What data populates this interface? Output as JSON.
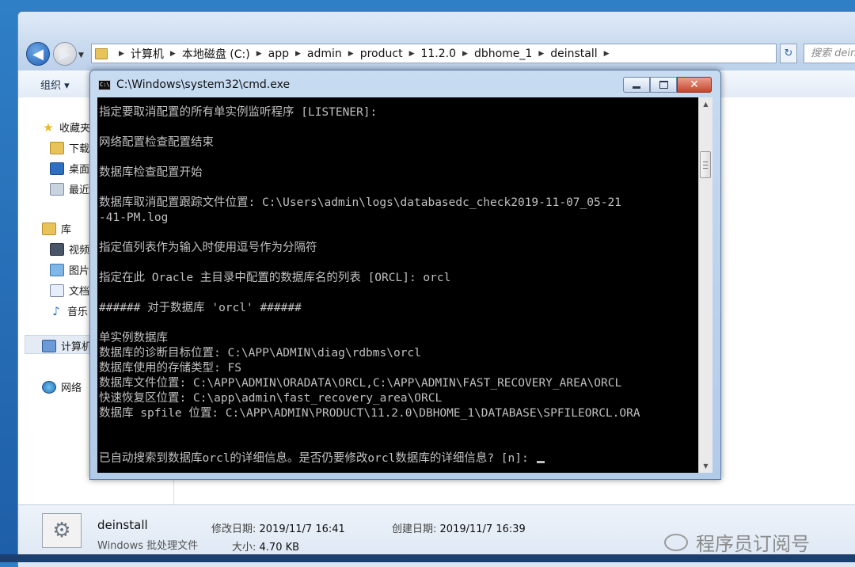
{
  "explorer": {
    "address_crumbs": [
      "计算机",
      "本地磁盘 (C:)",
      "app",
      "admin",
      "product",
      "11.2.0",
      "dbhome_1",
      "deinstall"
    ],
    "search_placeholder": "搜索 deinstall",
    "toolbar": {
      "organize_label": "组织 ▾"
    },
    "sidebar": {
      "favorites": "收藏夹",
      "downloads": "下载",
      "desktop": "桌面",
      "recent": "最近访问的位置",
      "libraries": "库",
      "videos": "视频",
      "pictures": "图片",
      "documents": "文档",
      "music": "音乐",
      "computer": "计算机",
      "network": "网络"
    },
    "details": {
      "name": "deinstall",
      "type": "Windows 批处理文件",
      "modified_label": "修改日期:",
      "modified_value": "2019/11/7 16:41",
      "created_label": "创建日期:",
      "created_value": "2019/11/7 16:39",
      "size_label": "大小:",
      "size_value": "4.70 KB"
    },
    "watermark": "程序员订阅号"
  },
  "cmd": {
    "title": "C:\\Windows\\system32\\cmd.exe",
    "icon_text": "C:\\",
    "lines": [
      "指定要取消配置的所有单实例监听程序 [LISTENER]:",
      "",
      "网络配置检查配置结束",
      "",
      "数据库检查配置开始",
      "",
      "数据库取消配置跟踪文件位置: C:\\Users\\admin\\logs\\databasedc_check2019-11-07_05-21",
      "-41-PM.log",
      "",
      "指定值列表作为输入时使用逗号作为分隔符",
      "",
      "指定在此 Oracle 主目录中配置的数据库名的列表 [ORCL]: orcl",
      "",
      "###### 对于数据库 'orcl' ######",
      "",
      "单实例数据库",
      "数据库的诊断目标位置: C:\\APP\\ADMIN\\diag\\rdbms\\orcl",
      "数据库使用的存储类型: FS",
      "数据库文件位置: C:\\APP\\ADMIN\\ORADATA\\ORCL,C:\\APP\\ADMIN\\FAST_RECOVERY_AREA\\ORCL",
      "快速恢复区位置: C:\\app\\admin\\fast_recovery_area\\ORCL",
      "数据库 spfile 位置: C:\\APP\\ADMIN\\PRODUCT\\11.2.0\\DBHOME_1\\DATABASE\\SPFILEORCL.ORA",
      "",
      "",
      ""
    ],
    "prompt": "已自动搜索到数据库orcl的详细信息。是否仍要修改orcl数据库的详细信息? [n]: "
  },
  "icons": {
    "back": "back-arrow-icon",
    "forward": "forward-arrow-icon",
    "refresh": "refresh-icon",
    "minimize": "minimize-icon",
    "maximize": "maximize-icon",
    "close": "close-icon"
  }
}
